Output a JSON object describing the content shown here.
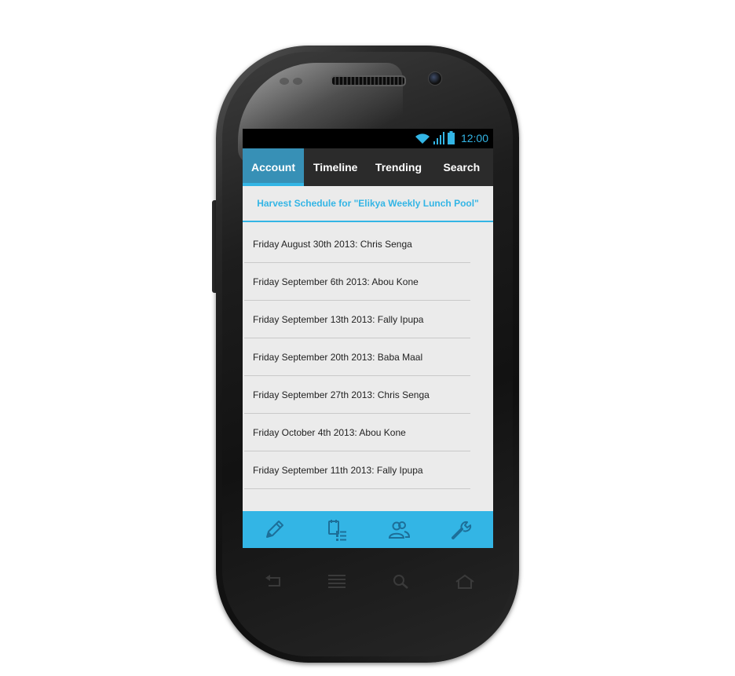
{
  "status": {
    "time": "12:00"
  },
  "tabs": [
    {
      "label": "Account",
      "active": true
    },
    {
      "label": "Timeline",
      "active": false
    },
    {
      "label": "Trending",
      "active": false
    },
    {
      "label": "Search",
      "active": false
    }
  ],
  "header": {
    "title": "Harvest Schedule for \"Elikya Weekly Lunch Pool\""
  },
  "schedule": [
    "Friday August 30th 2013: Chris Senga",
    "Friday September 6th 2013: Abou Kone",
    "Friday September 13th 2013: Fally Ipupa",
    "Friday September 20th 2013: Baba Maal",
    "Friday September 27th 2013: Chris Senga",
    "Friday October 4th 2013: Abou Kone",
    "Friday September 11th 2013: Fally Ipupa"
  ],
  "bottom_bar": [
    "pencil-icon",
    "calendar-list-icon",
    "people-icon",
    "wrench-icon"
  ],
  "hardware_buttons": [
    "back-icon",
    "menu-icon",
    "search-icon",
    "home-icon"
  ],
  "colors": {
    "accent": "#33b5e5",
    "active_tab": "#3790b6",
    "tab_bar": "#2b2b2b",
    "screen_bg": "#ebebeb"
  }
}
